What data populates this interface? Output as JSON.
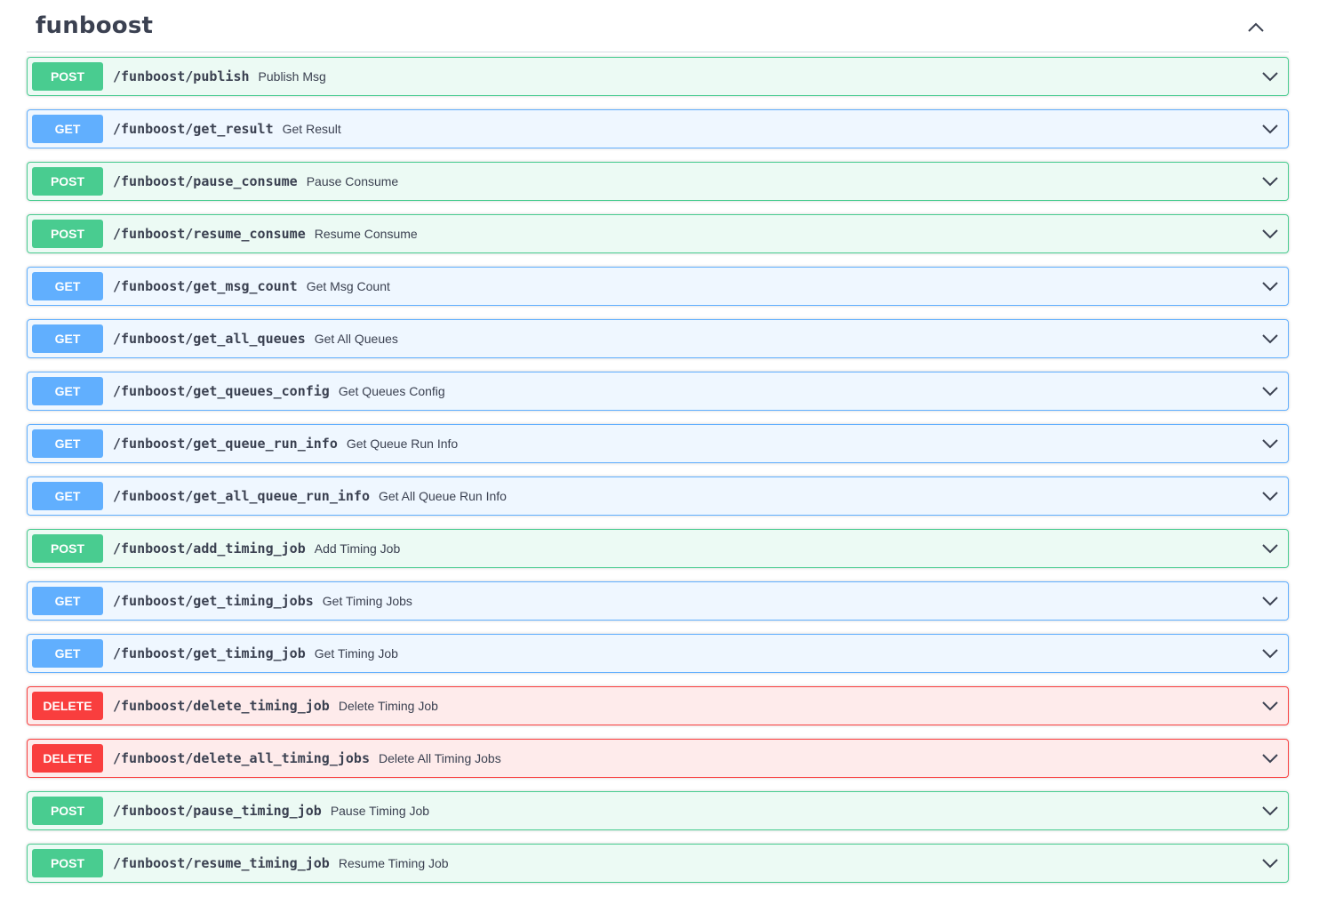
{
  "tag": {
    "title": "funboost"
  },
  "operations": [
    {
      "method": "POST",
      "path": "/funboost/publish",
      "summary": "Publish Msg"
    },
    {
      "method": "GET",
      "path": "/funboost/get_result",
      "summary": "Get Result"
    },
    {
      "method": "POST",
      "path": "/funboost/pause_consume",
      "summary": "Pause Consume"
    },
    {
      "method": "POST",
      "path": "/funboost/resume_consume",
      "summary": "Resume Consume"
    },
    {
      "method": "GET",
      "path": "/funboost/get_msg_count",
      "summary": "Get Msg Count"
    },
    {
      "method": "GET",
      "path": "/funboost/get_all_queues",
      "summary": "Get All Queues"
    },
    {
      "method": "GET",
      "path": "/funboost/get_queues_config",
      "summary": "Get Queues Config"
    },
    {
      "method": "GET",
      "path": "/funboost/get_queue_run_info",
      "summary": "Get Queue Run Info"
    },
    {
      "method": "GET",
      "path": "/funboost/get_all_queue_run_info",
      "summary": "Get All Queue Run Info"
    },
    {
      "method": "POST",
      "path": "/funboost/add_timing_job",
      "summary": "Add Timing Job"
    },
    {
      "method": "GET",
      "path": "/funboost/get_timing_jobs",
      "summary": "Get Timing Jobs"
    },
    {
      "method": "GET",
      "path": "/funboost/get_timing_job",
      "summary": "Get Timing Job"
    },
    {
      "method": "DELETE",
      "path": "/funboost/delete_timing_job",
      "summary": "Delete Timing Job"
    },
    {
      "method": "DELETE",
      "path": "/funboost/delete_all_timing_jobs",
      "summary": "Delete All Timing Jobs"
    },
    {
      "method": "POST",
      "path": "/funboost/pause_timing_job",
      "summary": "Pause Timing Job"
    },
    {
      "method": "POST",
      "path": "/funboost/resume_timing_job",
      "summary": "Resume Timing Job"
    }
  ],
  "colors": {
    "post": "#49cc90",
    "get": "#61affe",
    "delete": "#f93e3e",
    "text": "#3b4151"
  },
  "icons": {
    "collapse": "chevron-up-icon",
    "expand": "chevron-down-icon"
  }
}
